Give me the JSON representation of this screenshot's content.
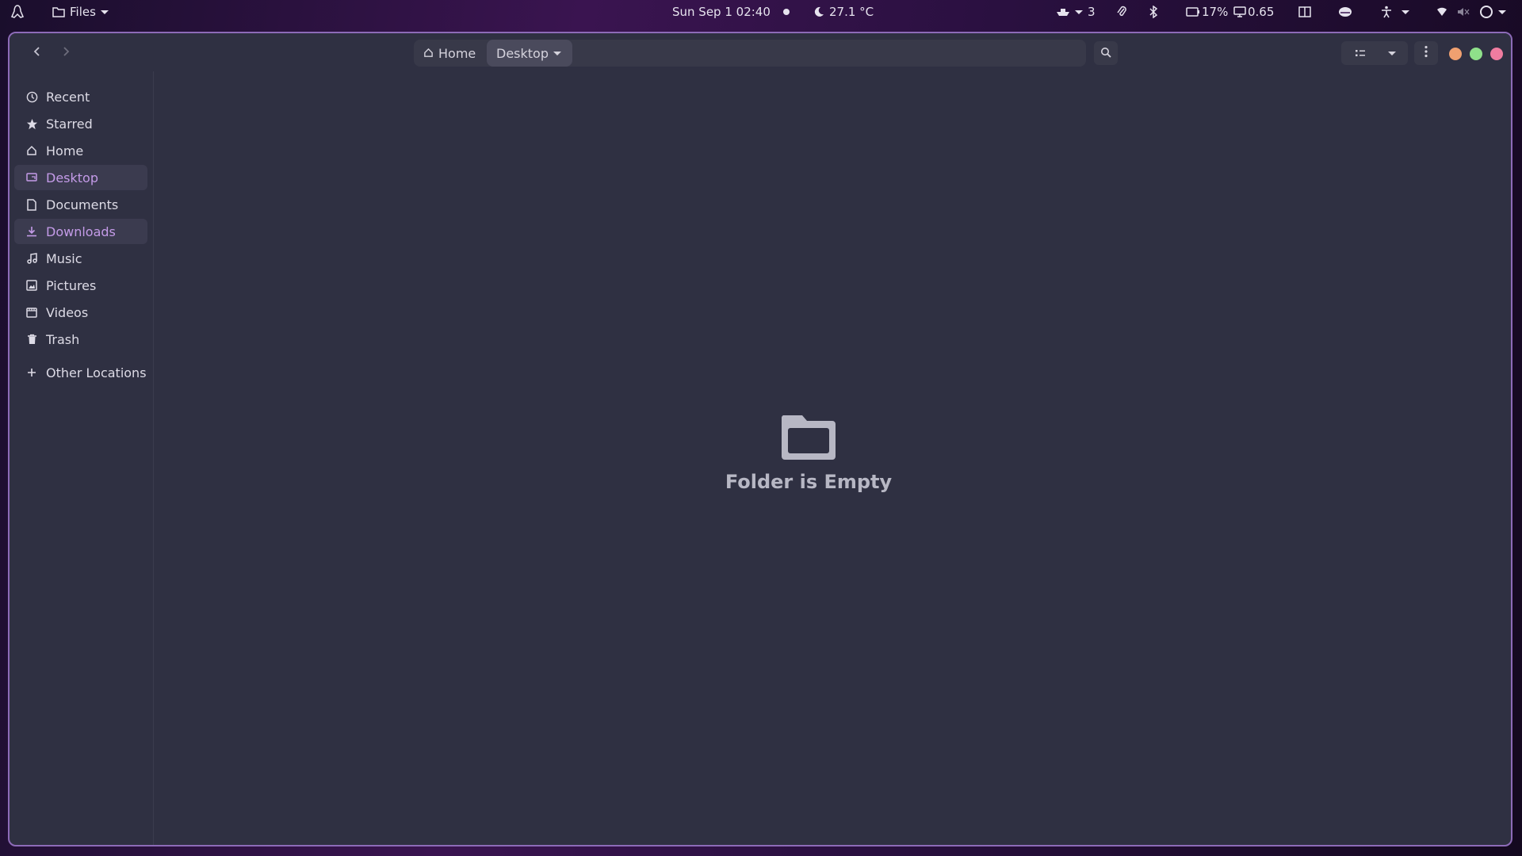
{
  "topbar": {
    "app_name": "Files",
    "datetime": "Sun Sep 1  02:40",
    "weather": "27.1 °C",
    "notification_count": "3",
    "battery": "17%",
    "load": "0.65"
  },
  "header": {
    "breadcrumbs": [
      {
        "label": "Home"
      },
      {
        "label": "Desktop"
      }
    ]
  },
  "sidebar": {
    "items": [
      {
        "label": "Recent",
        "icon": "clock-icon"
      },
      {
        "label": "Starred",
        "icon": "star-icon"
      },
      {
        "label": "Home",
        "icon": "home-icon"
      },
      {
        "label": "Desktop",
        "icon": "desktop-icon"
      },
      {
        "label": "Documents",
        "icon": "document-icon"
      },
      {
        "label": "Downloads",
        "icon": "download-icon"
      },
      {
        "label": "Music",
        "icon": "music-icon"
      },
      {
        "label": "Pictures",
        "icon": "picture-icon"
      },
      {
        "label": "Videos",
        "icon": "video-icon"
      },
      {
        "label": "Trash",
        "icon": "trash-icon"
      }
    ],
    "other_locations": "Other Locations"
  },
  "main": {
    "empty_message": "Folder is Empty"
  },
  "colors": {
    "accent": "#c49be8",
    "window_bg": "#2f3042",
    "window_border": "#8d6bb8",
    "minimize": "#f0a070",
    "maximize": "#8fe08a",
    "close": "#f07ca0"
  }
}
